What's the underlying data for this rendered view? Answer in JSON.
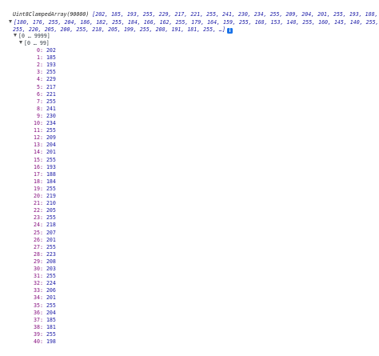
{
  "console": {
    "summary_type": "Uint8ClampedArray(90000)",
    "summary_values": "[202, 185, 193, 255, 229, 217, 221, 255, 241, 230, 234, 255, 209, 204, 201, 255, 193, 188, 1…",
    "preview_line1": "[180, 176, 255, 204, 186, 182, 255, 184, 166, 162, 255, 179, 164, 159, 255, 168, 153, 148, 255, 160, 145, 140, 255, 1",
    "preview_line2": "255, 220, 205, 200, 255, 218, 205, 199, 255, 208, 191, 181, 255, …]",
    "range_outer": "[0 … 9999]",
    "range_inner": "[0 … 99]",
    "entries": [
      {
        "k": "0",
        "v": "202"
      },
      {
        "k": "1",
        "v": "185"
      },
      {
        "k": "2",
        "v": "193"
      },
      {
        "k": "3",
        "v": "255"
      },
      {
        "k": "4",
        "v": "229"
      },
      {
        "k": "5",
        "v": "217"
      },
      {
        "k": "6",
        "v": "221"
      },
      {
        "k": "7",
        "v": "255"
      },
      {
        "k": "8",
        "v": "241"
      },
      {
        "k": "9",
        "v": "230"
      },
      {
        "k": "10",
        "v": "234"
      },
      {
        "k": "11",
        "v": "255"
      },
      {
        "k": "12",
        "v": "209"
      },
      {
        "k": "13",
        "v": "204"
      },
      {
        "k": "14",
        "v": "201"
      },
      {
        "k": "15",
        "v": "255"
      },
      {
        "k": "16",
        "v": "193"
      },
      {
        "k": "17",
        "v": "188"
      },
      {
        "k": "18",
        "v": "184"
      },
      {
        "k": "19",
        "v": "255"
      },
      {
        "k": "20",
        "v": "219"
      },
      {
        "k": "21",
        "v": "210"
      },
      {
        "k": "22",
        "v": "205"
      },
      {
        "k": "23",
        "v": "255"
      },
      {
        "k": "24",
        "v": "218"
      },
      {
        "k": "25",
        "v": "207"
      },
      {
        "k": "26",
        "v": "201"
      },
      {
        "k": "27",
        "v": "255"
      },
      {
        "k": "28",
        "v": "223"
      },
      {
        "k": "29",
        "v": "208"
      },
      {
        "k": "30",
        "v": "203"
      },
      {
        "k": "31",
        "v": "255"
      },
      {
        "k": "32",
        "v": "224"
      },
      {
        "k": "33",
        "v": "206"
      },
      {
        "k": "34",
        "v": "201"
      },
      {
        "k": "35",
        "v": "255"
      },
      {
        "k": "36",
        "v": "204"
      },
      {
        "k": "37",
        "v": "185"
      },
      {
        "k": "38",
        "v": "181"
      },
      {
        "k": "39",
        "v": "255"
      },
      {
        "k": "40",
        "v": "198"
      }
    ]
  },
  "colors": {
    "key": "#881280",
    "number": "#1a1aa6",
    "info_badge": "#1a73e8"
  },
  "icons": {
    "expand": "triangle-down-icon",
    "info": "info-icon"
  }
}
